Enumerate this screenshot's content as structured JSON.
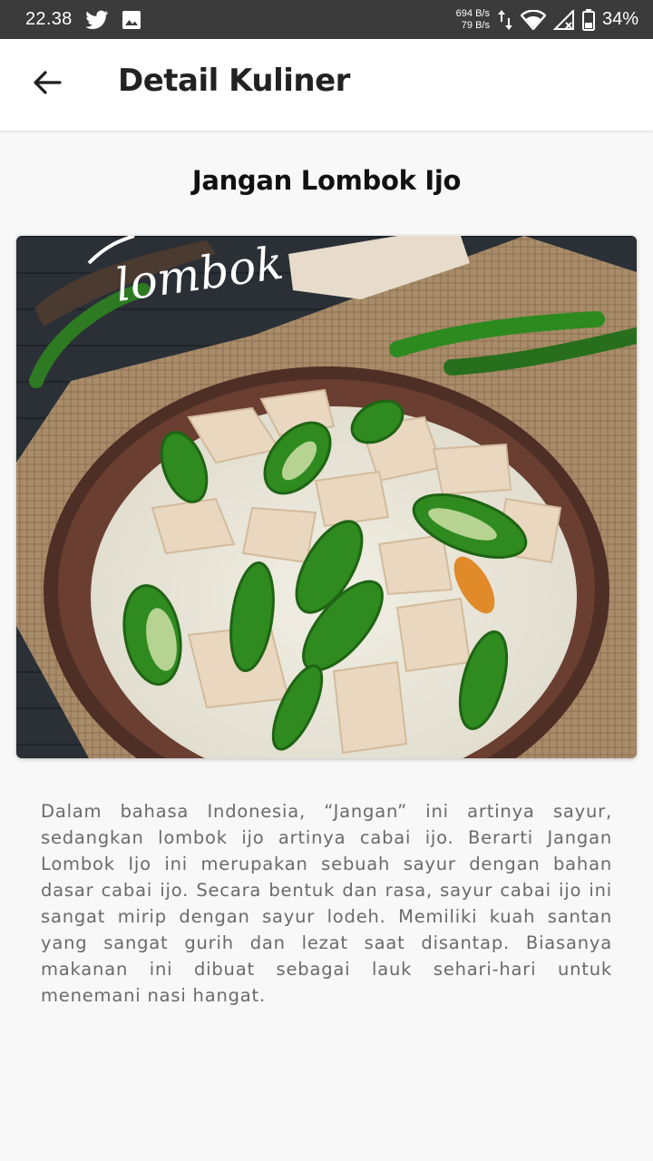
{
  "status_bar": {
    "time": "22.38",
    "net_up": "694 B/s",
    "net_down": "79 B/s",
    "battery": "34%",
    "icons": [
      "twitter-icon",
      "image-icon",
      "data-arrows-icon",
      "wifi-icon",
      "signal-icon",
      "battery-icon"
    ]
  },
  "app_bar": {
    "title": "Detail Kuliner",
    "back_icon": "arrow-left-icon"
  },
  "content": {
    "title": "Jangan Lombok Ijo",
    "image_caption_text": "lombok",
    "description": "Dalam bahasa Indonesia, “Jangan” ini artinya sayur, sedangkan lombok ijo artinya cabai ijo. Berarti Jangan Lombok Ijo ini merupakan sebuah sayur dengan bahan dasar cabai ijo.  Secara bentuk dan rasa, sayur cabai ijo ini sangat mirip dengan sayur lodeh. Memiliki kuah santan yang sangat gurih dan lezat saat disantap.  Biasanya makanan ini dibuat sebagai lauk sehari-hari untuk menemani nasi hangat."
  },
  "colors": {
    "status_bar": "#3b3b3b",
    "app_bar": "#ffffff",
    "background": "#f8f8f8",
    "chili_green": "#2f8a1f",
    "broth": "#ece8dc"
  }
}
